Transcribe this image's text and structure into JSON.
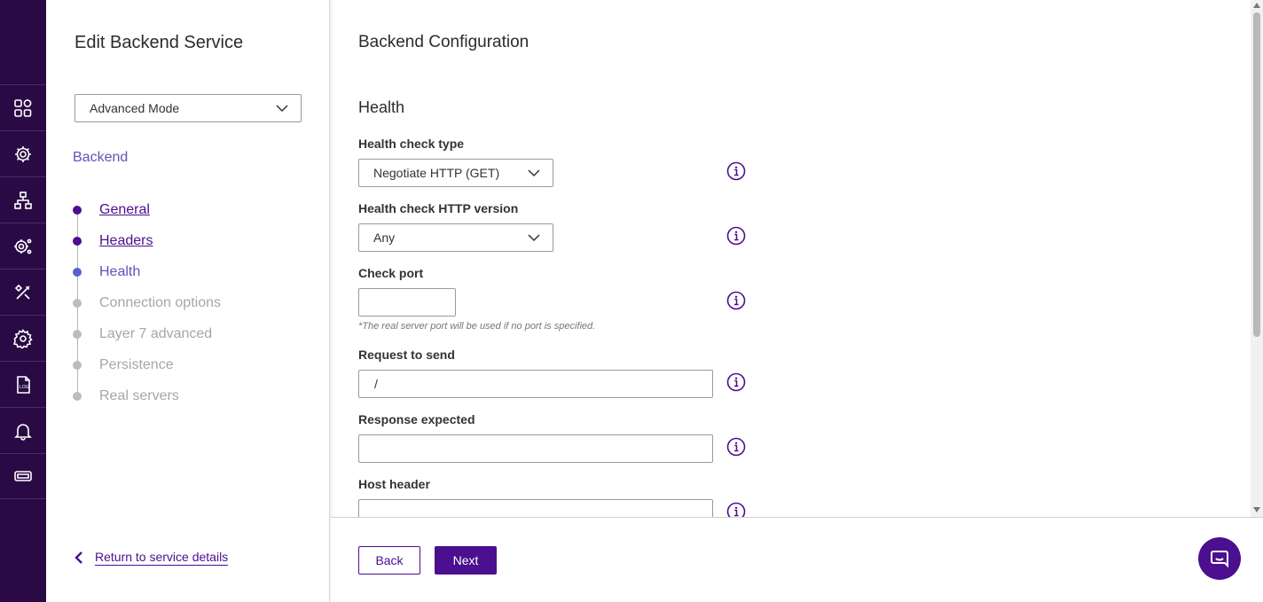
{
  "rail": {
    "icons": [
      "dashboard-icon",
      "services-icon",
      "network-icon",
      "system-settings-icon",
      "tools-icon",
      "settings-icon",
      "log-icon",
      "notifications-icon",
      "ticket-icon"
    ],
    "log_text": "LOG"
  },
  "nav": {
    "title": "Edit Backend Service",
    "mode_value": "Advanced Mode",
    "section_label": "Backend",
    "steps": [
      {
        "label": "General",
        "state": "done"
      },
      {
        "label": "Headers",
        "state": "done"
      },
      {
        "label": "Health",
        "state": "current"
      },
      {
        "label": "Connection options",
        "state": "pending"
      },
      {
        "label": "Layer 7 advanced",
        "state": "pending"
      },
      {
        "label": "Persistence",
        "state": "pending"
      },
      {
        "label": "Real servers",
        "state": "pending"
      }
    ],
    "return_label": "Return to service details"
  },
  "main": {
    "title": "Backend Configuration",
    "section_title": "Health",
    "fields": {
      "health_check_type": {
        "label": "Health check type",
        "value": "Negotiate HTTP (GET)"
      },
      "http_version": {
        "label": "Health check HTTP version",
        "value": "Any"
      },
      "check_port": {
        "label": "Check port",
        "value": "",
        "hint": "*The real server port will be used if no port is specified."
      },
      "request_to_send": {
        "label": "Request to send",
        "value": "/"
      },
      "response_expected": {
        "label": "Response expected",
        "value": ""
      },
      "host_header": {
        "label": "Host header",
        "value": ""
      }
    }
  },
  "footer": {
    "back_label": "Back",
    "next_label": "Next"
  },
  "colors": {
    "accent": "#4b0f8f",
    "rail_bg": "#2a0a45",
    "current_step": "#5b55b8"
  }
}
